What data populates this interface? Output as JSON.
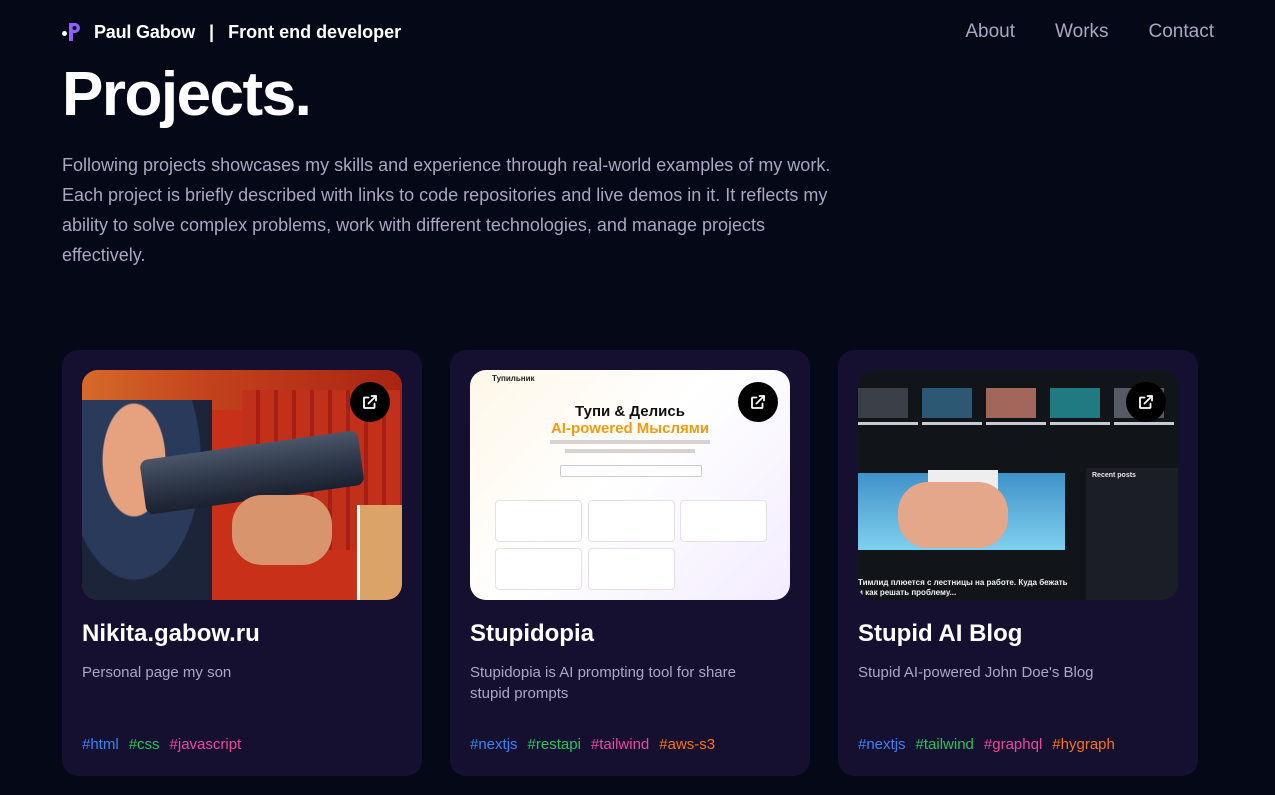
{
  "nav": {
    "brand_name": "Paul Gabow",
    "brand_separator": "|",
    "brand_role": "Front end developer",
    "links": [
      {
        "label": "About"
      },
      {
        "label": "Works"
      },
      {
        "label": "Contact"
      }
    ]
  },
  "hero": {
    "title": "Projects.",
    "intro": "Following projects showcases my skills and experience through real-world examples of my work. Each project is briefly described with links to code repositories and live demos in it. It reflects my ability to solve complex problems, work with different technologies, and manage projects effectively."
  },
  "projects": [
    {
      "title": "Nikita.gabow.ru",
      "description": "Personal page my son",
      "link_icon": "external-link-icon",
      "tags": [
        {
          "label": "#html",
          "color": "#3b82f6"
        },
        {
          "label": "#css",
          "color": "#22c55e"
        },
        {
          "label": "#javascript",
          "color": "#ec4899"
        }
      ]
    },
    {
      "title": "Stupidopia",
      "description": "Stupidopia is AI prompting tool for share stupid prompts",
      "link_icon": "external-link-icon",
      "thumb": {
        "header": "Тупильник",
        "heading_line1": "Тупи & Делись",
        "heading_line2": "AI-powered Мыслями"
      },
      "tags": [
        {
          "label": "#nextjs",
          "color": "#3b82f6"
        },
        {
          "label": "#restapi",
          "color": "#22c55e"
        },
        {
          "label": "#tailwind",
          "color": "#ec4899"
        },
        {
          "label": "#aws-s3",
          "color": "#f97316"
        }
      ]
    },
    {
      "title": "Stupid AI Blog",
      "description": "Stupid AI-powered John Doe's Blog",
      "link_icon": "external-link-icon",
      "thumb": {
        "caption": "Тимлид плюется с лестницы на работе. Куда бежать и как решать проблему...",
        "sidebar_title": "Recent posts"
      },
      "tags": [
        {
          "label": "#nextjs",
          "color": "#3b82f6"
        },
        {
          "label": "#tailwind",
          "color": "#22c55e"
        },
        {
          "label": "#graphql",
          "color": "#ec4899"
        },
        {
          "label": "#hygraph",
          "color": "#f97316"
        }
      ]
    }
  ],
  "colors": {
    "background": "#050816",
    "card": "#151030",
    "muted_text": "#aaa6c3",
    "accent": "#915eff"
  }
}
